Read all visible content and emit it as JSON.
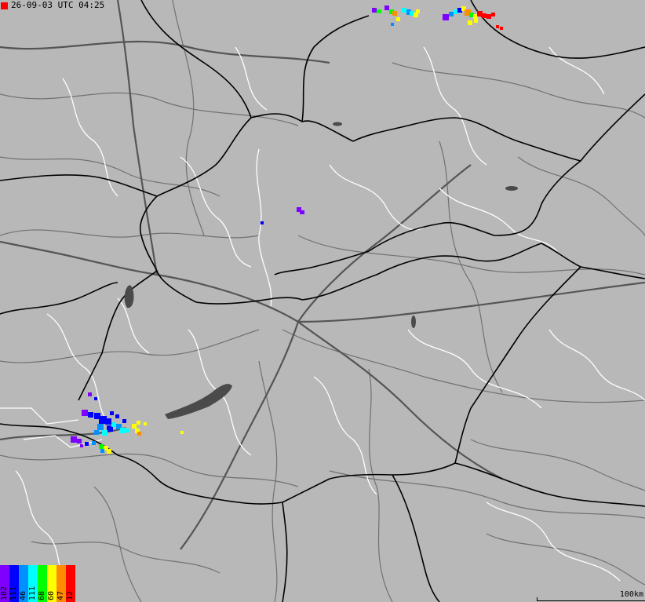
{
  "header": {
    "timestamp": "26-09-03 UTC 04:25",
    "marker_color": "#ff0000"
  },
  "map": {
    "land_color": "#b8b8b8",
    "water_color": "#4a4a4a",
    "border_color": "#000000",
    "road_color": "#6a6a6a",
    "region_border_color": "#ffffff",
    "scale_label": "100km"
  },
  "legend": [
    {
      "label": "102",
      "color": "#7f00ff"
    },
    {
      "label": "111",
      "color": "#0000ff"
    },
    {
      "label": "46",
      "color": "#0090ff"
    },
    {
      "label": "111",
      "color": "#00ffff"
    },
    {
      "label": "68",
      "color": "#00ff00"
    },
    {
      "label": "60",
      "color": "#ffff00"
    },
    {
      "label": "47",
      "color": "#ff8c00"
    },
    {
      "label": "12",
      "color": "#ff0000"
    }
  ]
}
